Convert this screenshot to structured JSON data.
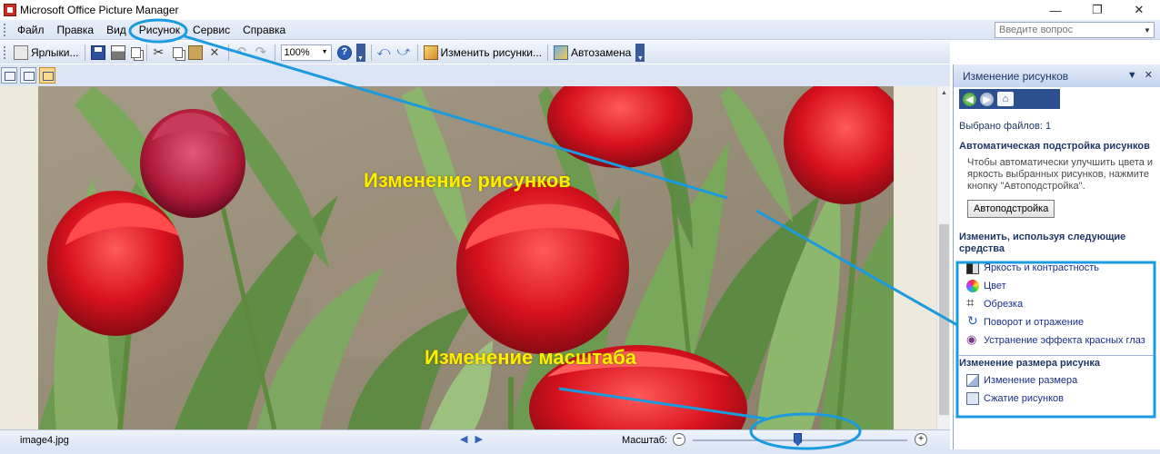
{
  "window": {
    "title": "Microsoft Office Picture Manager",
    "controls": {
      "minimize": "—",
      "maximize": "❐",
      "close": "✕"
    }
  },
  "menu": {
    "items": [
      "Файл",
      "Правка",
      "Вид",
      "Рисунок",
      "Сервис",
      "Справка"
    ],
    "help_placeholder": "Введите вопрос"
  },
  "toolbar": {
    "shortcuts_label": "Ярлыки...",
    "zoom_value": "100%",
    "edit_pictures_label": "Изменить рисунки...",
    "autocorrect_label": "Автозамена"
  },
  "status": {
    "filename": "image4.jpg",
    "zoom_label": "Масштаб:",
    "zoom_level_fraction": 0.49
  },
  "taskpane": {
    "title": "Изменение рисунков",
    "selected_count": "Выбрано файлов: 1",
    "auto_section_title": "Автоматическая подстройка рисунков",
    "auto_description": "Чтобы автоматически улучшить цвета и яркость выбранных рисунков, нажмите кнопку \"Автоподстройка\".",
    "auto_button": "Автоподстройка",
    "tools_section_title": "Изменить, используя следующие средства",
    "tools": [
      "Яркость и контрастность",
      "Цвет",
      "Обрезка",
      "Поворот и отражение",
      "Устранение эффекта красных глаз"
    ],
    "resize_section_title": "Изменение размера рисунка",
    "resize_tools": [
      "Изменение размера",
      "Сжатие рисунков"
    ]
  },
  "annotations": {
    "edit_pictures": "Изменение рисунков",
    "zoom_change": "Изменение масштаба",
    "highlight_color": "#1a9be0",
    "text_color": "#ffee00"
  }
}
